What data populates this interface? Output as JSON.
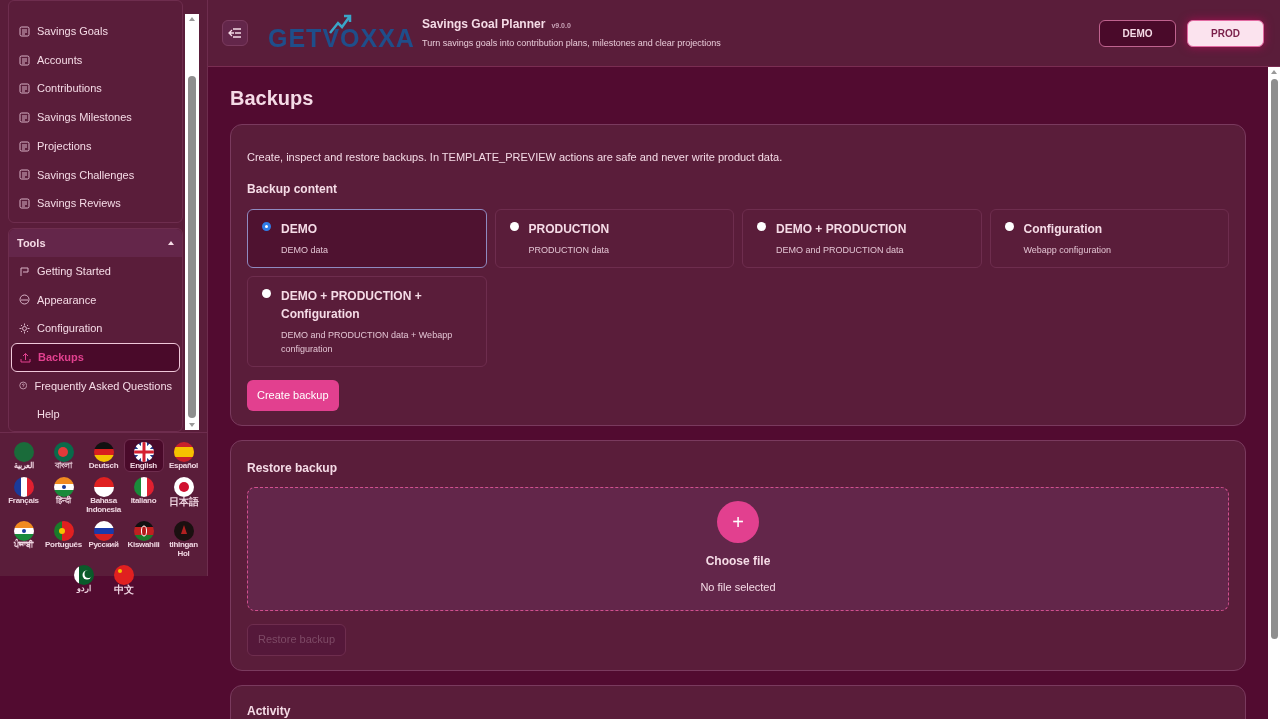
{
  "sidebar": {
    "nav_items": [
      {
        "label": "Savings Goals"
      },
      {
        "label": "Accounts"
      },
      {
        "label": "Contributions"
      },
      {
        "label": "Savings Milestones"
      },
      {
        "label": "Projections"
      },
      {
        "label": "Savings Challenges"
      },
      {
        "label": "Savings Reviews"
      }
    ],
    "tools": {
      "title": "Tools",
      "expanded": true,
      "items": [
        {
          "label": "Getting Started",
          "selected": false
        },
        {
          "label": "Appearance",
          "selected": false
        },
        {
          "label": "Configuration",
          "selected": false
        },
        {
          "label": "Backups",
          "selected": true
        },
        {
          "label": "Frequently Asked Questions",
          "selected": false
        },
        {
          "label": "Help",
          "selected": false
        }
      ]
    },
    "languages": [
      {
        "label": "العربية",
        "selected": false
      },
      {
        "label": "বাংলা",
        "selected": false
      },
      {
        "label": "Deutsch",
        "selected": false
      },
      {
        "label": "English",
        "selected": true
      },
      {
        "label": "Español",
        "selected": false
      },
      {
        "label": "Français",
        "selected": false
      },
      {
        "label": "हिन्दी",
        "selected": false
      },
      {
        "label": "Bahasa Indonesia",
        "selected": false
      },
      {
        "label": "Italiano",
        "selected": false
      },
      {
        "label": "日本語",
        "selected": false
      },
      {
        "label": "ਪੰਜਾਬੀ",
        "selected": false
      },
      {
        "label": "Português",
        "selected": false
      },
      {
        "label": "Русский",
        "selected": false
      },
      {
        "label": "Kiswahili",
        "selected": false
      },
      {
        "label": "tlhIngan Hol",
        "selected": false
      },
      {
        "label": "اردو",
        "selected": false
      },
      {
        "label": "中文",
        "selected": false
      }
    ]
  },
  "header": {
    "logo": "GETVOXXA",
    "title": "Savings Goal Planner",
    "version": "v9.0.0",
    "subtitle": "Turn savings goals into contribution plans, milestones and clear projections",
    "modes": [
      {
        "label": "DEMO",
        "selected": false
      },
      {
        "label": "PROD",
        "selected": true
      }
    ]
  },
  "page": {
    "title": "Backups",
    "backup_card": {
      "intro": "Create, inspect and restore backups. In TEMPLATE_PREVIEW actions are safe and never write product data.",
      "section_title": "Backup content",
      "options": [
        {
          "label": "DEMO",
          "description": "DEMO data",
          "selected": true
        },
        {
          "label": "PRODUCTION",
          "description": "PRODUCTION data",
          "selected": false
        },
        {
          "label": "DEMO + PRODUCTION",
          "description": "DEMO and PRODUCTION data",
          "selected": false
        },
        {
          "label": "Configuration",
          "description": "Webapp configuration",
          "selected": false
        },
        {
          "label": "DEMO + PRODUCTION + Configuration",
          "description": "DEMO and PRODUCTION data + Webapp configuration",
          "selected": false
        }
      ],
      "button": "Create backup"
    },
    "restore_card": {
      "title": "Restore backup",
      "drop_label": "Choose file",
      "file_status": "No file selected",
      "plus": "+",
      "button": {
        "label": "Restore backup",
        "disabled": true
      }
    },
    "activity_card": {
      "title": "Activity"
    }
  }
}
